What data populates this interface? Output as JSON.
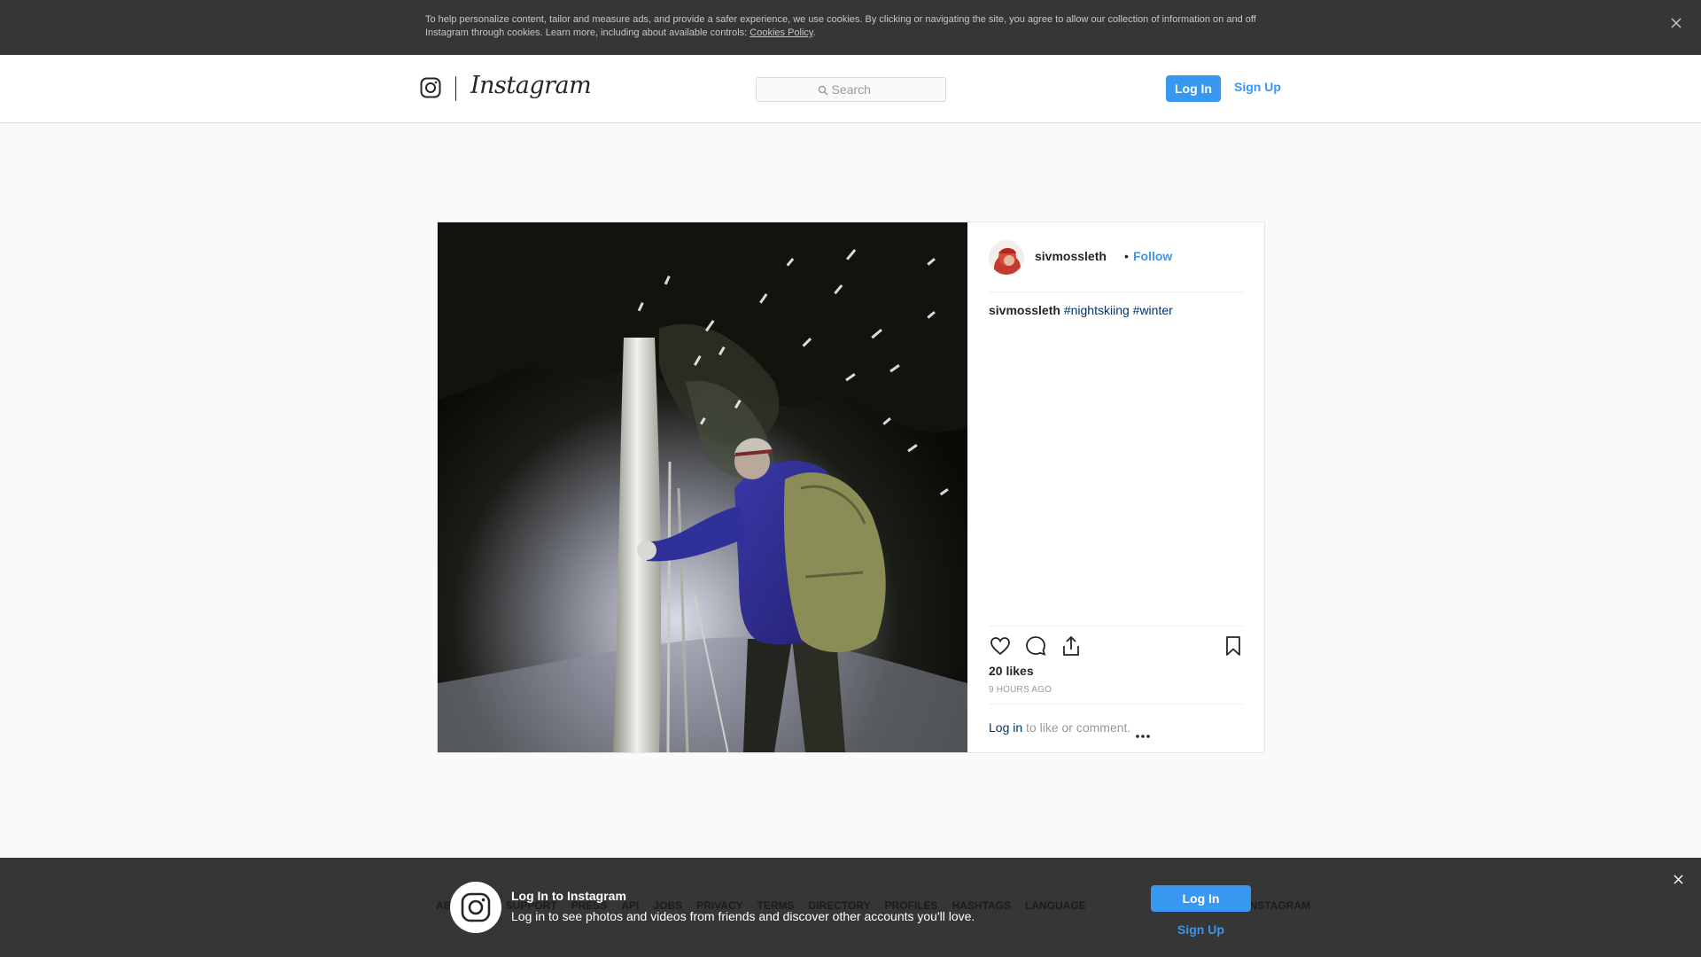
{
  "cookie_banner": {
    "text": "To help personalize content, tailor and measure ads, and provide a safer experience, we use cookies. By clicking or navigating the site, you agree to allow our collection of information on and off Instagram through cookies. Learn more, including about available controls: ",
    "link_label": "Cookies Policy",
    "close_icon": "close-icon"
  },
  "header": {
    "wordmark": "Instagram",
    "search_placeholder": "Search",
    "login_label": "Log In",
    "signup_label": "Sign Up"
  },
  "post": {
    "username": "sivmossleth",
    "separator": "•",
    "follow_label": "Follow",
    "caption_user": "sivmossleth",
    "hashtags": [
      "#nightskiing",
      "#winter"
    ],
    "likes": "20 likes",
    "time_ago": "9 HOURS AGO",
    "login_link": "Log in",
    "login_suffix": " to like or comment.",
    "photo_subject": "Night cross-country skier with backpack in falling snow beside a tree"
  },
  "footer": {
    "links": [
      "ABOUT US",
      "SUPPORT",
      "PRESS",
      "API",
      "JOBS",
      "PRIVACY",
      "TERMS",
      "DIRECTORY",
      "PROFILES",
      "HASHTAGS",
      "LANGUAGE"
    ],
    "copyright": "© 2018 INSTAGRAM"
  },
  "login_prompt": {
    "title": "Log In to Instagram",
    "subtitle": "Log in to see photos and videos from friends and discover other accounts you'll love.",
    "login_label": "Log In",
    "signup_label": "Sign Up"
  },
  "colors": {
    "accent": "#3897f0",
    "banner_bg": "#363636",
    "hashtag": "#003569"
  }
}
